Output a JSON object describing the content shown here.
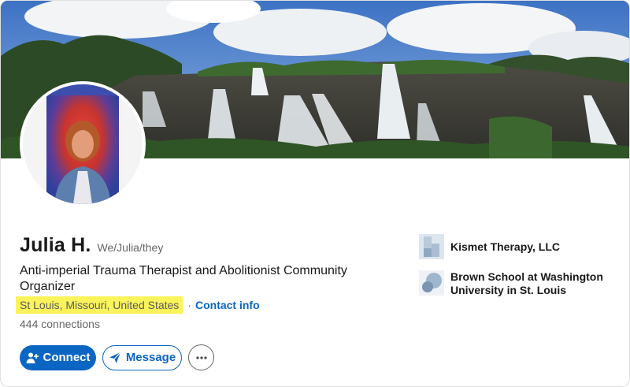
{
  "profile": {
    "name": "Julia H.",
    "pronouns": "We/Julia/they",
    "headline": "Anti-imperial Trauma Therapist and Abolitionist Community Organizer",
    "location": "St Louis, Missouri, United States",
    "separator": "·",
    "contact_info_label": "Contact info",
    "connections": "444 connections"
  },
  "actions": {
    "connect_label": "Connect",
    "message_label": "Message"
  },
  "experience": [
    {
      "name": "Kismet Therapy, LLC"
    },
    {
      "name": "Brown School at Washington University in St. Louis"
    }
  ],
  "colors": {
    "accent": "#0a66c2",
    "location_highlight": "#fbf35a"
  },
  "icons": {
    "connect": "add-person-icon",
    "message": "send-icon",
    "more": "more-horizontal-icon"
  }
}
